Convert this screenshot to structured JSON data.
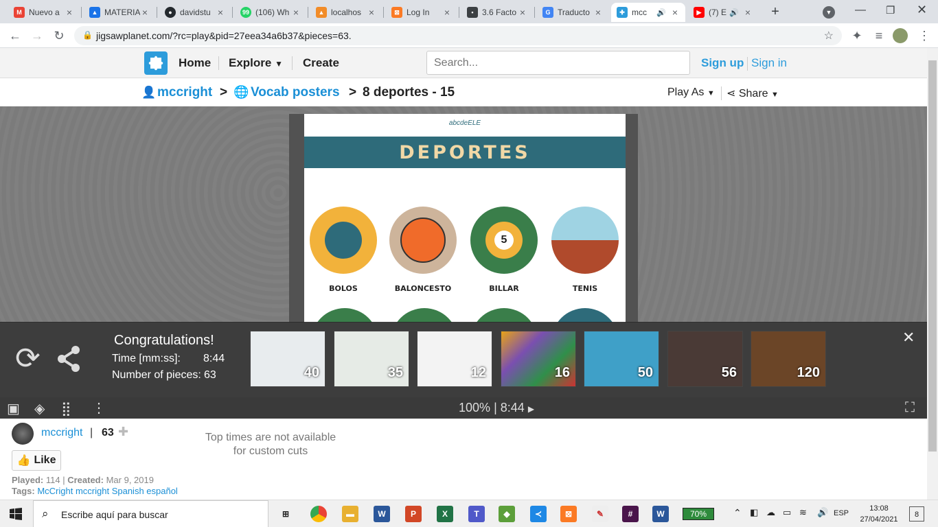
{
  "browser": {
    "tabs": [
      {
        "title": "Nuevo a",
        "icon": "gmail-icon",
        "color": "#ea4335"
      },
      {
        "title": "MATERIA",
        "icon": "drive-icon",
        "color": "#1a73e8"
      },
      {
        "title": "davidstu",
        "icon": "github-icon",
        "color": "#24292e"
      },
      {
        "title": "(106) Wh",
        "icon": "whatsapp-icon",
        "color": "#25d366"
      },
      {
        "title": "localhos",
        "icon": "pma-icon",
        "color": "#f28c28"
      },
      {
        "title": "Log In",
        "icon": "xampp-icon",
        "color": "#fb7a24"
      },
      {
        "title": "3.6 Facto",
        "icon": "contact-icon",
        "color": "#3c4043"
      },
      {
        "title": "Traducto",
        "icon": "translate-icon",
        "color": "#4285f4"
      },
      {
        "title": "mcc",
        "icon": "jigsaw-icon",
        "color": "#2d9cdb"
      },
      {
        "title": "(7) E",
        "icon": "youtube-icon",
        "color": "#ff0000"
      }
    ],
    "url": "jigsawplanet.com/?rc=play&pid=27eea34a6b37&pieces=63."
  },
  "site": {
    "nav": {
      "home": "Home",
      "explore": "Explore",
      "create": "Create"
    },
    "search_placeholder": "Search...",
    "sign_up": "Sign up",
    "sign_in": "Sign in"
  },
  "breadcrumb": {
    "user": "mccright",
    "sep1": ">",
    "collection": "Vocab posters",
    "sep2": ">",
    "puzzle": "8 deportes - 15",
    "play_as": "Play As",
    "share": "Share"
  },
  "poster": {
    "header": "abcdeELE",
    "title": "DEPORTES",
    "sports": [
      "BOLOS",
      "BALONCESTO",
      "BILLAR",
      "TENIS"
    ]
  },
  "congrats": {
    "title": "Congratulations!",
    "time_label": "Time [mm:ss]:",
    "time_value": "8:44",
    "pieces_label": "Number of pieces:",
    "pieces_value": "63",
    "suggestions": [
      {
        "count": "40",
        "color": "#e8ecee"
      },
      {
        "count": "35",
        "color": "#e6ebe6"
      },
      {
        "count": "12",
        "color": "#f3f3f3"
      },
      {
        "count": "16",
        "color": "#7a4fb0"
      },
      {
        "count": "50",
        "color": "#3fa0c8"
      },
      {
        "count": "56",
        "color": "#4a3a36"
      },
      {
        "count": "120",
        "color": "#6b4527"
      }
    ]
  },
  "status": {
    "zoom": "100%",
    "sep": "|",
    "time": "8:44"
  },
  "info": {
    "user": "mccright",
    "sep": "|",
    "score": "63",
    "like": "Like",
    "top_times": "Top times are not available",
    "top_times2": "for custom cuts",
    "played_label": "Played:",
    "played": "114",
    "created_label": "Created:",
    "created": "Mar 9, 2019",
    "tags_label": "Tags:",
    "tags": "McCright mccright Spanish español"
  },
  "taskbar": {
    "search": "Escribe aquí para buscar",
    "battery": "70%",
    "lang": "ESP",
    "time": "13:08",
    "date": "27/04/2021",
    "notif": "8"
  }
}
